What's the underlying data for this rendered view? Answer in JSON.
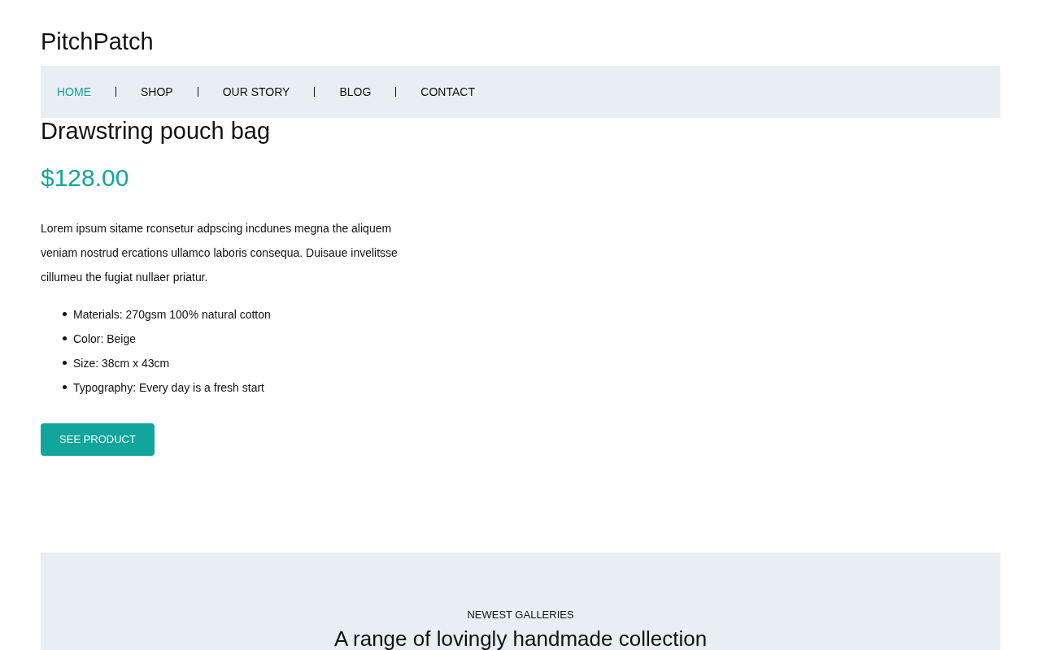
{
  "logo": {
    "text": "PitchPatch"
  },
  "nav": {
    "items": [
      {
        "label": "HOME",
        "selected": true
      },
      {
        "label": "SHOP",
        "selected": false
      },
      {
        "label": "OUR STORY",
        "selected": false
      },
      {
        "label": "BLOG",
        "selected": false
      },
      {
        "label": "CONTACT",
        "selected": false
      }
    ]
  },
  "product": {
    "title": "Drawstring pouch bag",
    "price": "$128.00",
    "description": "Lorem ipsum sitame rconsetur adpscing incdunes megna the aliquem veniam nostrud ercations ullamco laboris consequa. Duisaue invelitsse cillumeu the fugiat nullaer priatur.",
    "features": [
      "Materials: 270gsm 100% natural cotton",
      "Color: Beige",
      "Size: 38cm x 43cm",
      "Typography: Every day is a fresh start"
    ],
    "button": "SEE PRODUCT"
  },
  "gallery_section": {
    "eyebrow": "NEWEST GALLERIES",
    "heading": "A range of lovingly handmade collection"
  }
}
